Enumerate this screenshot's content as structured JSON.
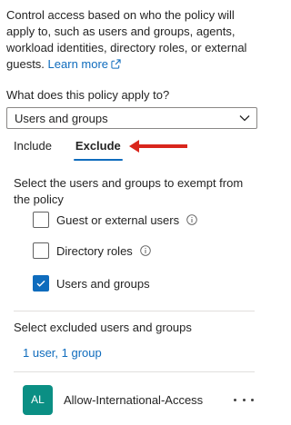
{
  "intro": {
    "text": "Control access based on who the policy will apply to, such as users and groups, agents, workload identities, directory roles, or external guests.",
    "learn_more": "Learn more"
  },
  "applies_to": {
    "label": "What does this policy apply to?",
    "selected": "Users and groups"
  },
  "tabs": [
    {
      "label": "Include",
      "active": false
    },
    {
      "label": "Exclude",
      "active": true
    }
  ],
  "exclude": {
    "description": "Select the users and groups to exempt from the policy",
    "options": [
      {
        "label": "Guest or external users",
        "checked": false,
        "info": true
      },
      {
        "label": "Directory roles",
        "checked": false,
        "info": true
      },
      {
        "label": "Users and groups",
        "checked": true,
        "info": false
      }
    ],
    "select_label": "Select excluded users and groups",
    "selection_summary": "1 user, 1 group",
    "items": [
      {
        "initials": "AL",
        "name": "Allow-International-Access"
      }
    ]
  },
  "colors": {
    "accent": "#0f6cbd",
    "avatar_bg": "#0b8f84",
    "arrow": "#d9261c"
  }
}
